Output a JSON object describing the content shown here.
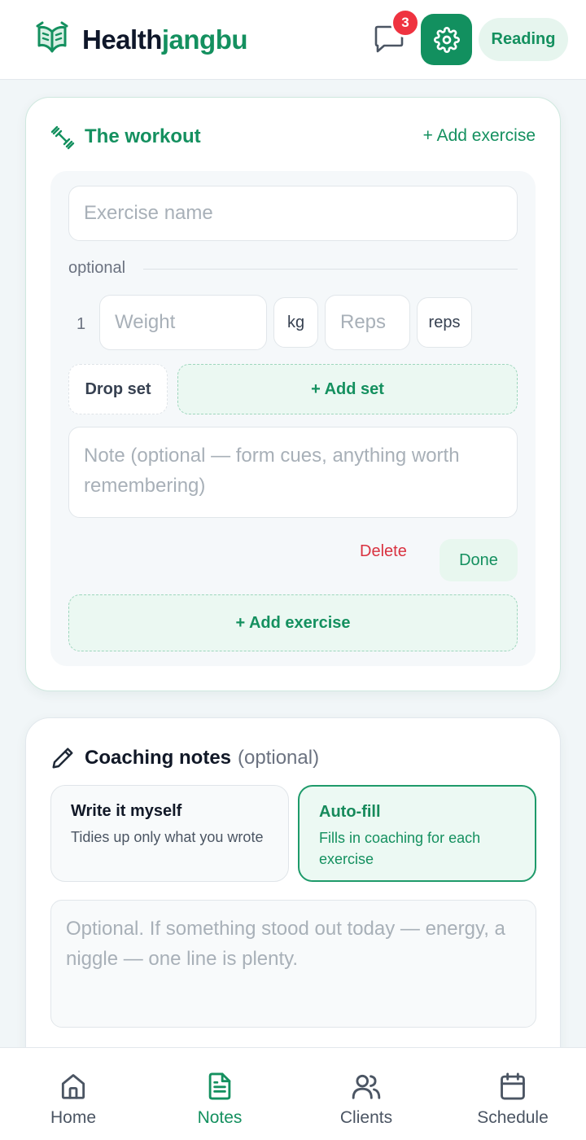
{
  "header": {
    "brand_primary": "Health",
    "brand_accent": "jangbu",
    "notification_count": "3",
    "mode_label": "Reading"
  },
  "workout": {
    "title": "The workout",
    "add_exercise_link": "+ Add exercise",
    "exercise_name_placeholder": "Exercise name",
    "optional_label": "optional",
    "set_number": "1",
    "weight_placeholder": "Weight",
    "weight_unit": "kg",
    "reps_placeholder": "Reps",
    "reps_unit": "reps",
    "drop_set_label": "Drop set",
    "add_set_label": "+ Add set",
    "note_placeholder": "Note (optional — form cues, anything worth remembering)",
    "delete_label": "Delete",
    "done_label": "Done",
    "add_exercise_button": "+ Add exercise"
  },
  "coaching": {
    "title": "Coaching notes",
    "title_suffix": "(optional)",
    "options": [
      {
        "title": "Write it myself",
        "description": "Tidies up only what you wrote",
        "selected": false
      },
      {
        "title": "Auto-fill",
        "description": "Fills in coaching for each exercise",
        "selected": true
      }
    ],
    "textarea_placeholder": "Optional. If something stood out today — energy, a niggle — one line is plenty."
  },
  "nav": {
    "items": [
      {
        "label": "Home",
        "icon": "home-icon",
        "active": false
      },
      {
        "label": "Notes",
        "icon": "notes-icon",
        "active": true
      },
      {
        "label": "Clients",
        "icon": "clients-icon",
        "active": false
      },
      {
        "label": "Schedule",
        "icon": "calendar-icon",
        "active": false
      }
    ]
  },
  "colors": {
    "accent": "#14905f",
    "danger": "#d93240",
    "badge": "#ef3340"
  }
}
